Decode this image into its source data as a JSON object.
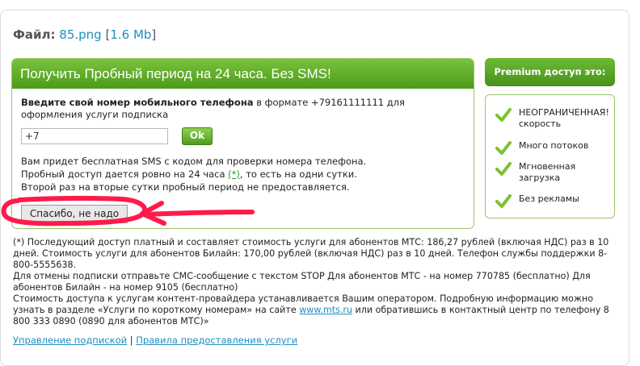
{
  "file": {
    "label": "Файл:",
    "name": "85.png",
    "size_open": "[",
    "size": "1.6 Mb",
    "size_close": "]"
  },
  "panel": {
    "title": "Получить Пробный период на 24 часа. Без SMS!",
    "intro_bold": "Введите свой номер мобильного телефона",
    "intro_rest": " в формате +79161111111 для оформления услуги подписка",
    "phone_value": "+7",
    "ok_label": "Ok",
    "info_1": "Вам придет бесплатная SMS с кодом для проверки номера телефона.",
    "info_2a": "Пробный доступ дается ровно на 24 часа ",
    "info_2_link": "(*)",
    "info_2b": ", то есть на одни сутки.",
    "info_3": "Второй раз на вторые сутки пробный период не предоставляется.",
    "thanks_label": "Спасибо, не надо"
  },
  "premium": {
    "title": "Premium доступ это:",
    "features": [
      {
        "text": "НЕОГРАНИЧЕННАЯ! скорость",
        "icon": "check-icon"
      },
      {
        "text": "Много потоков",
        "icon": "check-icon"
      },
      {
        "text": "Мгновенная загрузка",
        "icon": "check-icon"
      },
      {
        "text": "Без рекламы",
        "icon": "check-icon"
      }
    ]
  },
  "footnote": {
    "p1": "(*) Последующий доступ платный и составляет стоимость услуги для абонентов МТС: 186,27 рублей (включая НДС) раз в 10 дней. Стоимость услуги для абонентов Билайн: 170,00 рублей (включая НДС) раз в 10 дней. Телефон службы поддержки 8-800-5555638.",
    "p2": "Для отмены подписки отправьте СМС-сообщение с текстом STOP Для абонентов МТС - на номер 770785 (бесплатно) Для абонентов Билайн - на номер 9105 (бесплатно)",
    "p3a": "Стоимость доступа к услугам контент-провайдера устанавливается Вашим оператором. Подробную информацию можно узнать в разделе «Услуги по короткому номерам» на сайте ",
    "p3_link": "www.mts.ru",
    "p3b": " или обратившись в контактный центр по телефону 8 800 333 0890 (0890 для абонентов МТС)»"
  },
  "links": {
    "manage": "Управление подпиской",
    "sep": "|",
    "rules": "Правила предоставления услуги"
  },
  "colors": {
    "green": "#5aa523",
    "link": "#1e8fbf",
    "annotation": "#ff1a4a"
  }
}
